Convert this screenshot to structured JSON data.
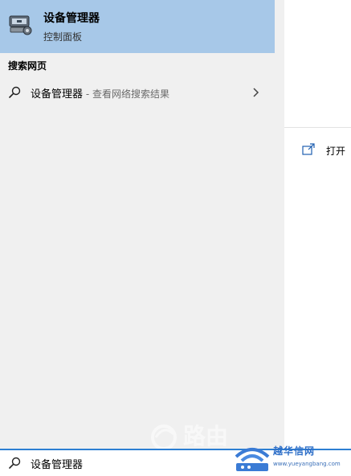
{
  "best_match": {
    "title": "设备管理器",
    "subtitle": "控制面板",
    "icon": "device-manager-icon"
  },
  "web_section": {
    "heading": "搜索网页",
    "item": {
      "query": "设备管理器",
      "suffix": " - 查看网络搜索结果",
      "icon": "search-icon",
      "arrow": "chevron-right-icon"
    }
  },
  "actions": [
    {
      "label": "打开",
      "icon": "open-icon"
    }
  ],
  "search": {
    "value": "设备管理器",
    "icon": "search-icon"
  },
  "watermark": {
    "left_text": "路由",
    "logo_title": "越华信网",
    "logo_url": "www.yueyangbang.com"
  },
  "colors": {
    "left_pane": "#f0f0f0",
    "best_match_highlight": "#a7c8e8",
    "search_border_accent": "#2d7fd3"
  }
}
